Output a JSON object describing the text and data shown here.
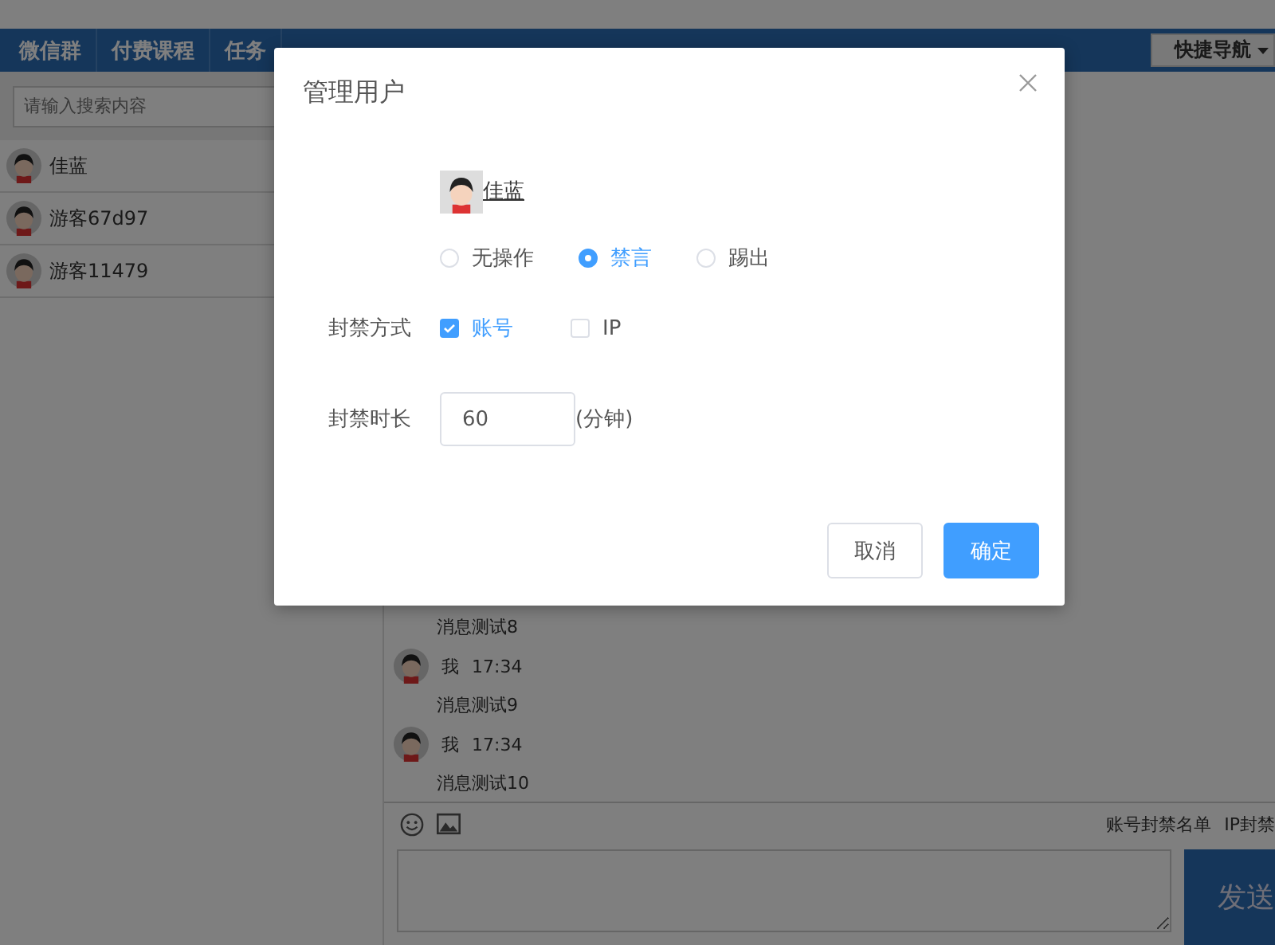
{
  "nav": {
    "items": [
      {
        "label": "微信群",
        "selected": false
      },
      {
        "label": "付费课程",
        "selected": false
      },
      {
        "label": "任务",
        "selected": false
      }
    ],
    "quick_nav": "快捷导航"
  },
  "search": {
    "placeholder": "请输入搜索内容"
  },
  "users": [
    {
      "name": "佳蓝"
    },
    {
      "name": "游客67d97"
    },
    {
      "name": "游客11479"
    }
  ],
  "messages": [
    {
      "text": "消息测试8"
    },
    {
      "sender": "我",
      "time": "17:34",
      "text": "消息测试9"
    },
    {
      "sender": "我",
      "time": "17:34",
      "text": "消息测试10"
    }
  ],
  "composer": {
    "links": [
      "账号封禁名单",
      "IP封禁"
    ],
    "send": "发送"
  },
  "dialog": {
    "title": "管理用户",
    "user": "佳蓝",
    "actions": [
      {
        "label": "无操作",
        "selected": false
      },
      {
        "label": "禁言",
        "selected": true
      },
      {
        "label": "踢出",
        "selected": false
      }
    ],
    "ban_label": "封禁方式",
    "ban_types": [
      {
        "label": "账号",
        "checked": true
      },
      {
        "label": "IP",
        "checked": false
      }
    ],
    "duration_label": "封禁时长",
    "duration": "60",
    "unit": "(分钟)",
    "buttons": [
      {
        "label": "取消",
        "kind": "secondary"
      },
      {
        "label": "确定",
        "kind": "primary"
      }
    ]
  }
}
